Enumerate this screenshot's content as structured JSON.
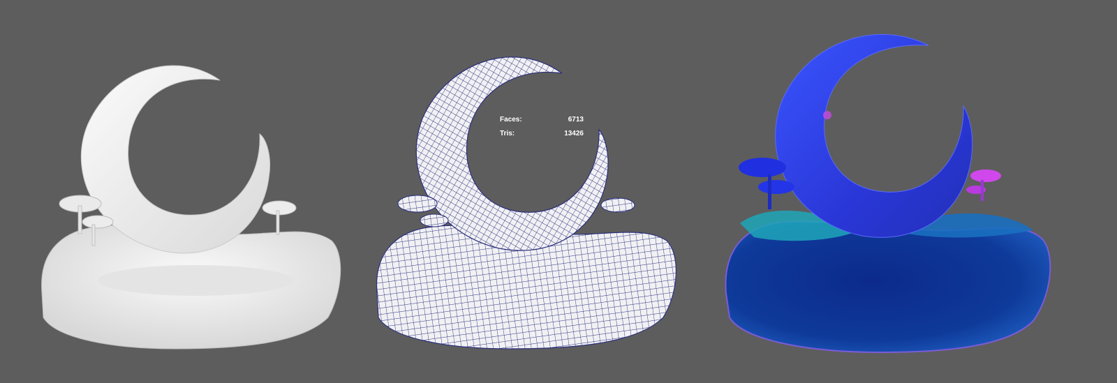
{
  "viewport": {
    "background": "#5d5d5d",
    "views": [
      "clay-shaded-render",
      "wireframe-render",
      "normal-map-render"
    ]
  },
  "stats": {
    "faces_label": "Faces:",
    "faces_value": "6713",
    "tris_label": "Tris:",
    "tris_value": "13426"
  },
  "colors": {
    "clay": "#f2f2f2",
    "wire": "#2b2f7a",
    "normal_blue": "#2d3be0",
    "normal_teal": "#1a8fb0",
    "normal_magenta": "#d040e8"
  }
}
